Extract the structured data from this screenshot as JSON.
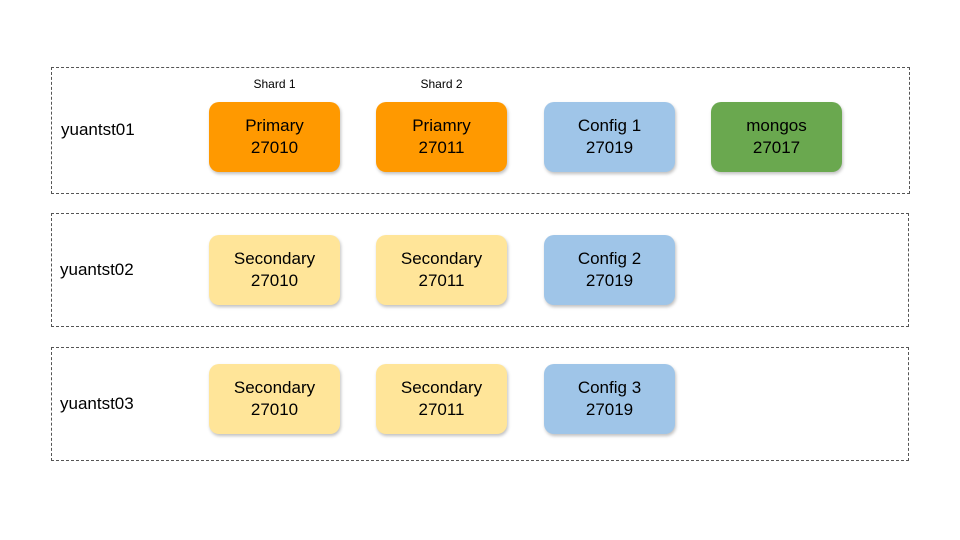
{
  "colors": {
    "primary": "#ff9900",
    "secondary": "#ffe599",
    "config": "#9fc5e8",
    "mongos": "#6aa84f"
  },
  "shard_labels": [
    "Shard 1",
    "Shard 2"
  ],
  "hosts": [
    {
      "name": "yuantst01",
      "nodes": [
        {
          "role": "Primary",
          "port": "27010"
        },
        {
          "role": "Priamry",
          "port": "27011"
        },
        {
          "role": "Config 1",
          "port": "27019"
        },
        {
          "role": "mongos",
          "port": "27017"
        }
      ]
    },
    {
      "name": "yuantst02",
      "nodes": [
        {
          "role": "Secondary",
          "port": "27010"
        },
        {
          "role": "Secondary",
          "port": "27011"
        },
        {
          "role": "Config 2",
          "port": "27019"
        }
      ]
    },
    {
      "name": "yuantst03",
      "nodes": [
        {
          "role": "Secondary",
          "port": "27010"
        },
        {
          "role": "Secondary",
          "port": "27011"
        },
        {
          "role": "Config 3",
          "port": "27019"
        }
      ]
    }
  ]
}
